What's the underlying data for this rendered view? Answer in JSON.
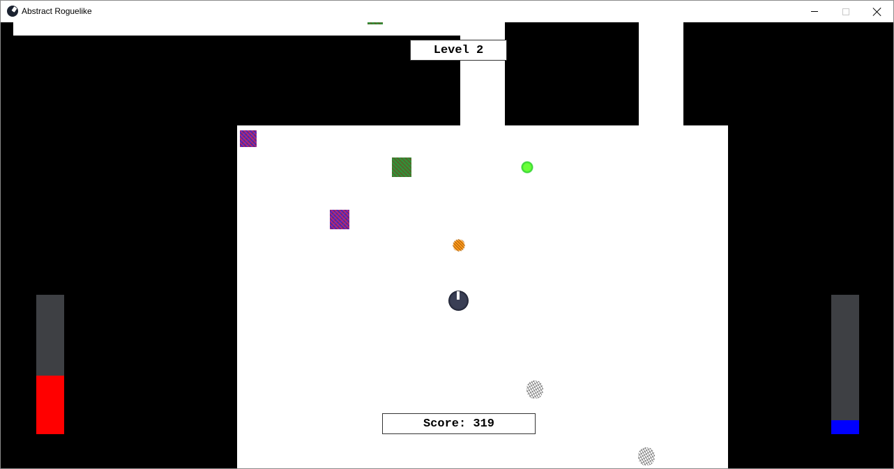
{
  "window": {
    "title": "Abstract Roguelike"
  },
  "hud": {
    "level_text": "Level 2",
    "score_text": "Score: 319",
    "health_fraction": 0.42,
    "mana_fraction": 0.1
  },
  "colors": {
    "wall": "#000000",
    "floor": "#ffffff",
    "bar_track": "#3e4044",
    "health": "#ff0000",
    "mana": "#0000ff"
  }
}
